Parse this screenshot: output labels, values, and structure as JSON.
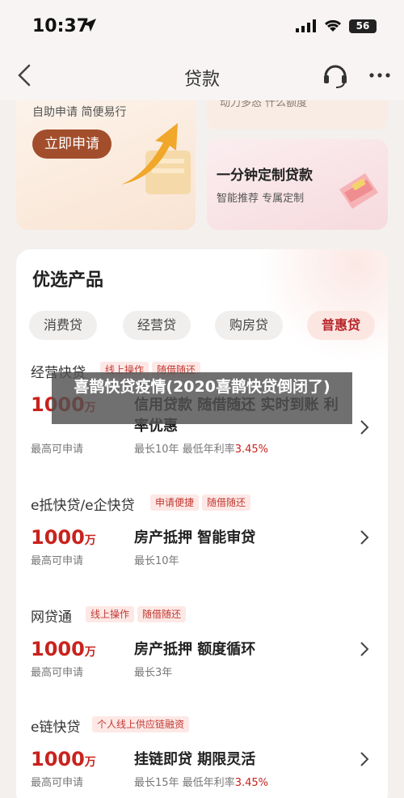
{
  "status_bar": {
    "time": "10:37",
    "battery": "56"
  },
  "nav": {
    "title": "贷款"
  },
  "top_cards": {
    "big_subtitle": "自助申请 简便易行",
    "apply_button": "立即申请",
    "small_top_text": "动力多态 什么额度",
    "small_title": "一分钟定制贷款",
    "small_subtitle": "智能推荐 专属定制"
  },
  "products": {
    "title": "优选产品",
    "tabs": [
      {
        "label": "消费贷"
      },
      {
        "label": "经营贷"
      },
      {
        "label": "购房贷"
      },
      {
        "label": "普惠贷",
        "active": true
      }
    ],
    "items": [
      {
        "name": "经营快贷",
        "tags": [
          "线上操作",
          "随借随还"
        ],
        "amount": "1000",
        "amount_unit": "万",
        "feature": "信用贷款 随借随还 实时到账 利率优惠",
        "left_label": "最高可申请",
        "right_label_prefix": "最长10年 最低年利率",
        "right_label_rate": "3.45%"
      },
      {
        "name": "e抵快贷/e企快贷",
        "tags": [
          "申请便捷",
          "随借随还"
        ],
        "amount": "1000",
        "amount_unit": "万",
        "feature": "房产抵押 智能审贷",
        "left_label": "最高可申请",
        "right_label_prefix": "最长10年",
        "right_label_rate": ""
      },
      {
        "name": "网贷通",
        "tags": [
          "线上操作",
          "随借随还"
        ],
        "amount": "1000",
        "amount_unit": "万",
        "feature": "房产抵押 额度循环",
        "left_label": "最高可申请",
        "right_label_prefix": "最长3年",
        "right_label_rate": ""
      },
      {
        "name": "e链快贷",
        "tags": [
          "个人线上供应链融资"
        ],
        "amount": "1000",
        "amount_unit": "万",
        "feature": "挂链即贷 期限灵活",
        "left_label": "最高可申请",
        "right_label_prefix": "最长15年 最低年利率",
        "right_label_rate": "3.45%"
      }
    ]
  },
  "overlay": {
    "text": "喜鹊快贷疫情(2020喜鹊快贷倒闭了)"
  }
}
